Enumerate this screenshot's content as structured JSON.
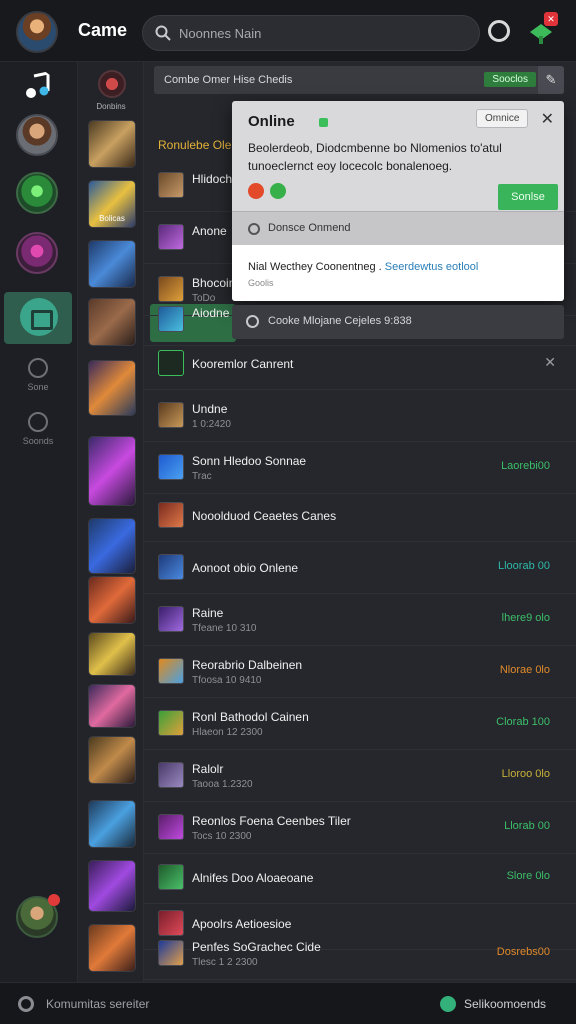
{
  "header": {
    "title": "Came",
    "search_placeholder": "Noonnes Nain"
  },
  "rail": {
    "items": [
      {
        "label": "Sone"
      },
      {
        "label": "Soonds"
      }
    ]
  },
  "col2": {
    "top_label": "Donbins",
    "thumb_label": "Bolicas"
  },
  "banner": {
    "text": "Combe Omer Hise Chedis",
    "button": "Sooclos",
    "tool_icon": "wrench-icon"
  },
  "section_title": "Ronulebe Ole",
  "popup": {
    "title": "Online",
    "option": "Omnice",
    "close": "✕",
    "body": "Beolerdeob, Diodcmbenne bo Nlomenios to'atul tunoeclernct eoy locecolc bonalenoeg.",
    "action": "Sonlse",
    "bar_text": "Donsce Onmend",
    "footer_text": "Nial Wecthey Coonentneg",
    "footer_link": "Seerdewtus eotlool",
    "footer_sub": "Goolis"
  },
  "subbar_text": "Cooke Mlojane Cejeles 9:838",
  "rows": [
    {
      "name": "Hlidocht",
      "sub": "",
      "stat": ""
    },
    {
      "name": "Anone",
      "sub": "",
      "stat": ""
    },
    {
      "name": "Bhocoin",
      "sub": "ToDo",
      "stat": ""
    },
    {
      "name": "Aiodne Isl",
      "sub": "",
      "stat": ""
    },
    {
      "name": "Kooremlor Canrent",
      "sub": "",
      "stat": "✕"
    },
    {
      "name": "Undne",
      "sub": "1 0:2420",
      "stat": ""
    },
    {
      "name": "Sonn Hledoo Sonnae",
      "sub": "Trac",
      "stat": "Laorebi00"
    },
    {
      "name": "Nooolduod Ceaetes Canes",
      "sub": "",
      "stat": ""
    },
    {
      "name": "Aonoot obio Onlene",
      "sub": "",
      "stat": "Lloorab 00"
    },
    {
      "name": "Raine",
      "sub": "Tfeane   10 310",
      "stat": "lhere9 olo"
    },
    {
      "name": "Reorabrio Dalbeinen",
      "sub": "Tfoosa   10 9410",
      "stat": "Nlorae 0lo"
    },
    {
      "name": "Ronl Bathodol Cainen",
      "sub": "Hlaeon   12 2300",
      "stat": "Clorab 100"
    },
    {
      "name": "Ralolr",
      "sub": "Taooa   1.2320",
      "stat": "Lloroo 0lo"
    },
    {
      "name": "Reonlos Foena Ceenbes Tiler",
      "sub": "Tocs   10 2300",
      "stat": "Llorab 00"
    },
    {
      "name": "Alnifes Doo Aloaeoane",
      "sub": "",
      "stat": "Slore 0lo"
    },
    {
      "name": "Apoolrs Aetioesioe",
      "sub": "",
      "stat": ""
    },
    {
      "name": "Penfes SoGrachec Cide",
      "sub": "Tlesc   1 2 2300",
      "stat": "Dosrebs00"
    }
  ],
  "bottom": {
    "left": "Komumitas sereiter",
    "right": "Selikoomoends"
  },
  "colors": {
    "accent_green": "#3ab45a",
    "section_gold": "#e2b23a",
    "stat_green": "#3bbf6a",
    "stat_teal": "#2fb7a8",
    "stat_orange": "#e08a2a",
    "stat_yellow": "#c9b23a"
  }
}
